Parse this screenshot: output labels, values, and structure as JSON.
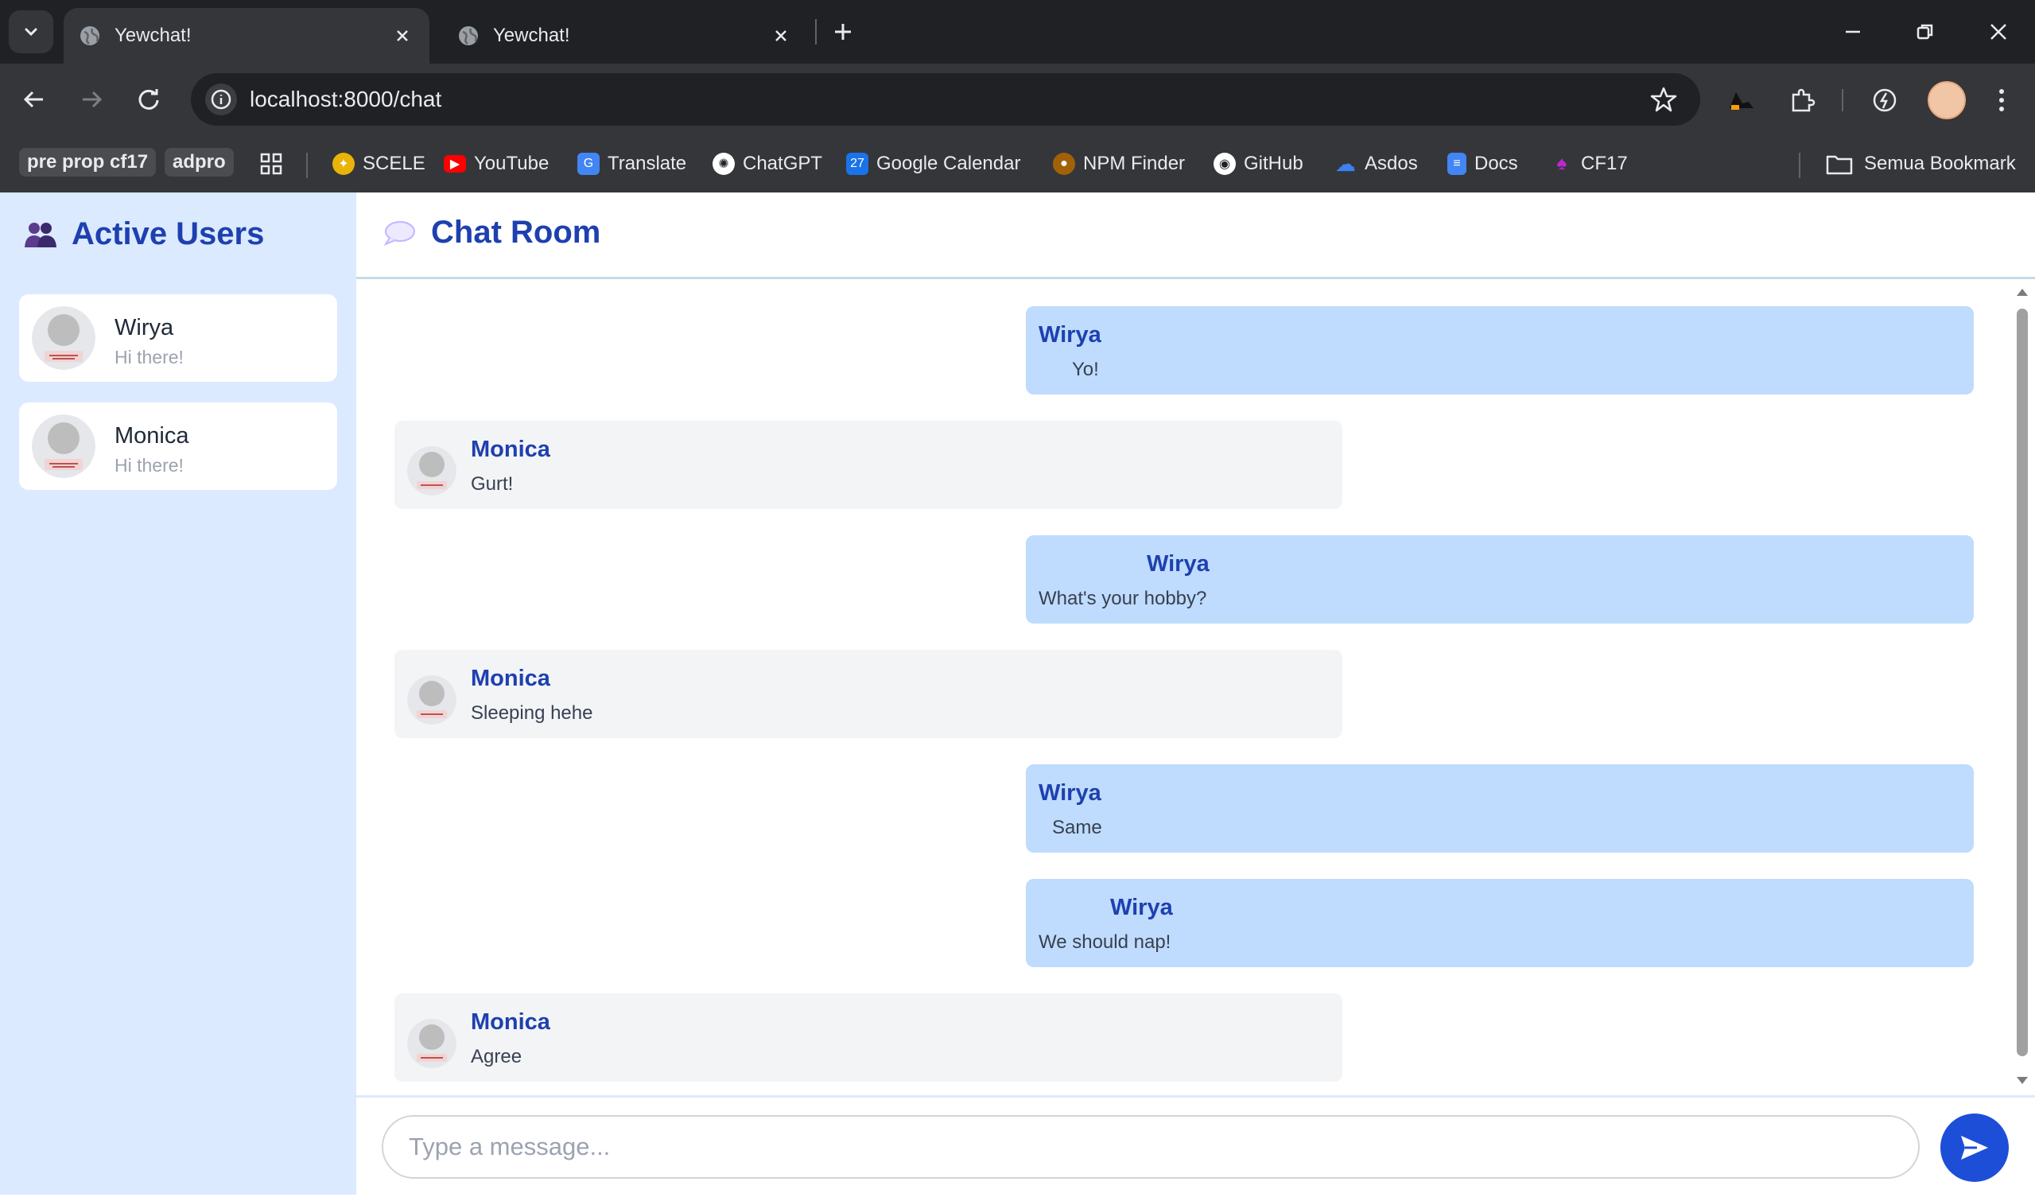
{
  "browser": {
    "tabs": [
      {
        "title": "Yewchat!",
        "active": true
      },
      {
        "title": "Yewchat!",
        "active": false
      }
    ],
    "url": "localhost:8000/chat",
    "bookmarks": [
      {
        "label": "pre prop cf17",
        "pill": true
      },
      {
        "label": "adpro",
        "pill": true
      },
      {
        "label": "SCELE",
        "icon": "scele-icon"
      },
      {
        "label": "YouTube",
        "icon": "youtube-icon"
      },
      {
        "label": "Translate",
        "icon": "translate-icon"
      },
      {
        "label": "ChatGPT",
        "icon": "chatgpt-icon"
      },
      {
        "label": "Google Calendar",
        "icon": "calendar-icon"
      },
      {
        "label": "NPM Finder",
        "icon": "npm-finder-icon"
      },
      {
        "label": "GitHub",
        "icon": "github-icon"
      },
      {
        "label": "Asdos",
        "icon": "cloud-icon"
      },
      {
        "label": "Docs",
        "icon": "docs-icon"
      },
      {
        "label": "CF17",
        "icon": "cf17-icon"
      }
    ],
    "all_bookmarks_label": "Semua Bookmark"
  },
  "sidebar": {
    "title": "Active Users",
    "users": [
      {
        "name": "Wirya",
        "status": "Hi there!"
      },
      {
        "name": "Monica",
        "status": "Hi there!"
      }
    ]
  },
  "chat": {
    "title": "Chat Room",
    "messages": [
      {
        "sender": "Wirya",
        "text": "Yo!",
        "outgoing": true
      },
      {
        "sender": "Monica",
        "text": "Gurt!",
        "outgoing": false
      },
      {
        "sender": "Wirya",
        "text": "What's your hobby?",
        "outgoing": true
      },
      {
        "sender": "Monica",
        "text": "Sleeping hehe",
        "outgoing": false
      },
      {
        "sender": "Wirya",
        "text": "Same",
        "outgoing": true
      },
      {
        "sender": "Wirya",
        "text": "We should nap!",
        "outgoing": true
      },
      {
        "sender": "Monica",
        "text": "Agree",
        "outgoing": false
      }
    ],
    "input_placeholder": "Type a message..."
  },
  "colors": {
    "accent": "#1e40af",
    "sidebar_bg": "#dbeafe",
    "outgoing_bubble": "#bfdbfe",
    "incoming_bubble": "#f3f4f6",
    "send_button": "#1d4ed8"
  }
}
